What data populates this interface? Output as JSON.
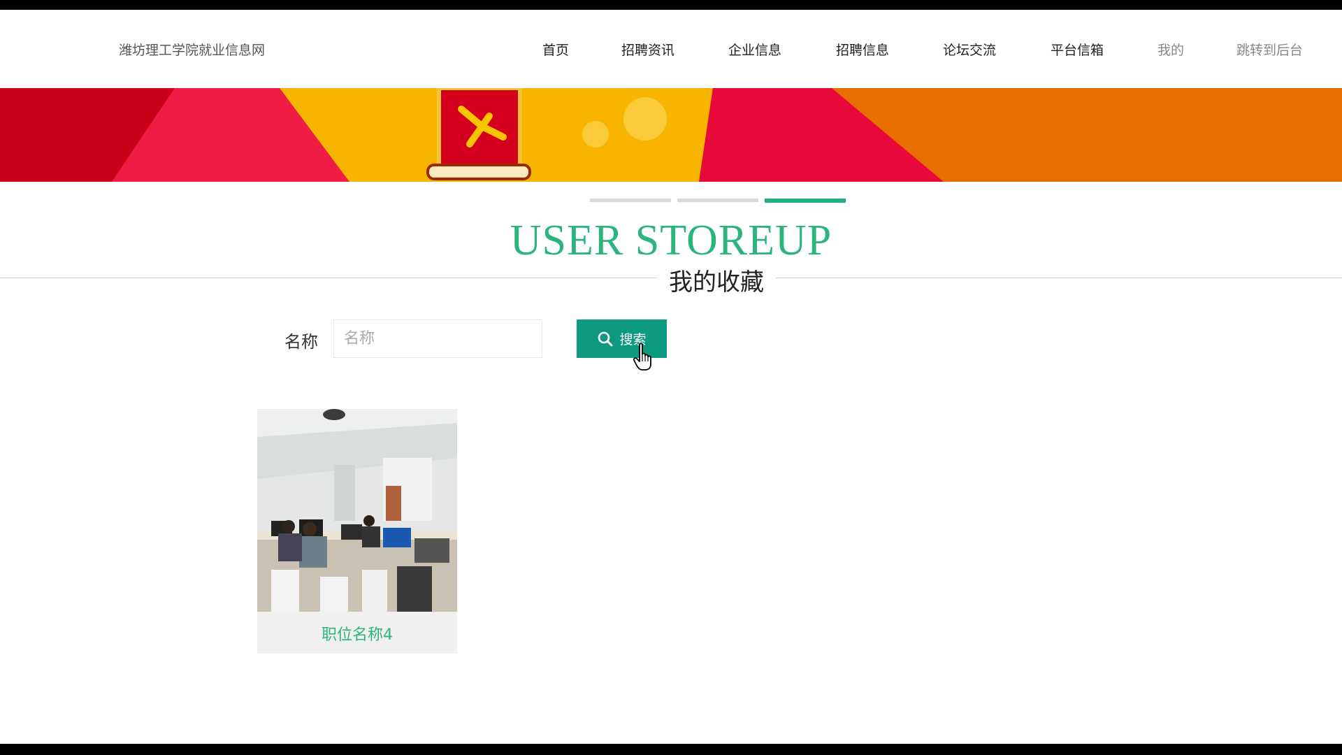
{
  "header": {
    "site_title": "潍坊理工学院就业信息网",
    "nav": [
      {
        "label": "首页",
        "name": "nav-home"
      },
      {
        "label": "招聘资讯",
        "name": "nav-recruit-news"
      },
      {
        "label": "企业信息",
        "name": "nav-company-info"
      },
      {
        "label": "招聘信息",
        "name": "nav-recruit-info"
      },
      {
        "label": "论坛交流",
        "name": "nav-forum"
      },
      {
        "label": "平台信箱",
        "name": "nav-mailbox"
      },
      {
        "label": "我的",
        "name": "nav-mine"
      },
      {
        "label": "跳转到后台",
        "name": "nav-admin"
      }
    ]
  },
  "section": {
    "title_en": "USER STOREUP",
    "title_cn": "我的收藏"
  },
  "search": {
    "label": "名称",
    "placeholder": "名称",
    "value": "",
    "button_label": "搜索"
  },
  "favorites": [
    {
      "title": "职位名称4"
    }
  ],
  "colors": {
    "accent": "#2bb57c",
    "button": "#0d9a7f",
    "banner_red": "#e8083a",
    "banner_yellow": "#f7b500",
    "banner_orange": "#e86e00"
  }
}
